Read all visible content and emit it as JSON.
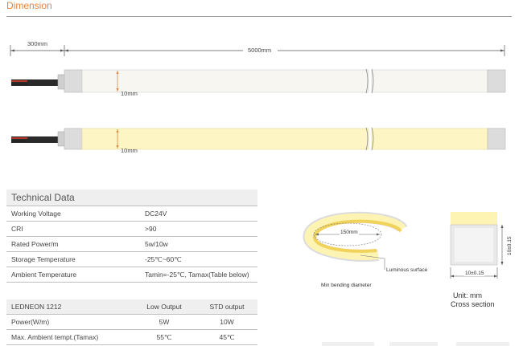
{
  "section_title": "Dimension",
  "dims": {
    "lead_length": "300mm",
    "strip_length": "5000mm",
    "height_top": "10mm",
    "height_bottom": "10mm"
  },
  "tech_table": {
    "heading": "Technical Data",
    "rows": [
      {
        "label": "Working Voltage",
        "value": "DC24V"
      },
      {
        "label": "CRI",
        "value": ">90"
      },
      {
        "label": "Rated Power/m",
        "value": "5w/10w"
      },
      {
        "label": "Storage Temperature",
        "value": "-25℃~60℃"
      },
      {
        "label": "Ambient Temperature",
        "value": "Tamin=-25℃, Tamax(Table below)"
      }
    ]
  },
  "output_table": {
    "headers": [
      "LEDNEON 1212",
      "Low Output",
      "STD output"
    ],
    "rows": [
      [
        "Power(W/m)",
        "5W",
        "10W"
      ],
      [
        "Max. Ambient tempt.(Tamax)",
        "55℃",
        "45℃"
      ]
    ]
  },
  "bend_diagram": {
    "diameter": "150mm",
    "surface_label": "Luminous surface",
    "caption": "Min bending diameter"
  },
  "cross_section": {
    "height_label": "10±0.15",
    "width_label": "10±0.15",
    "unit_label": "Unit: mm",
    "caption": "Cross section"
  },
  "colors": {
    "accent": "#e8833a",
    "warm_light": "#fdf5c4",
    "white_light": "#f7f6f0"
  }
}
